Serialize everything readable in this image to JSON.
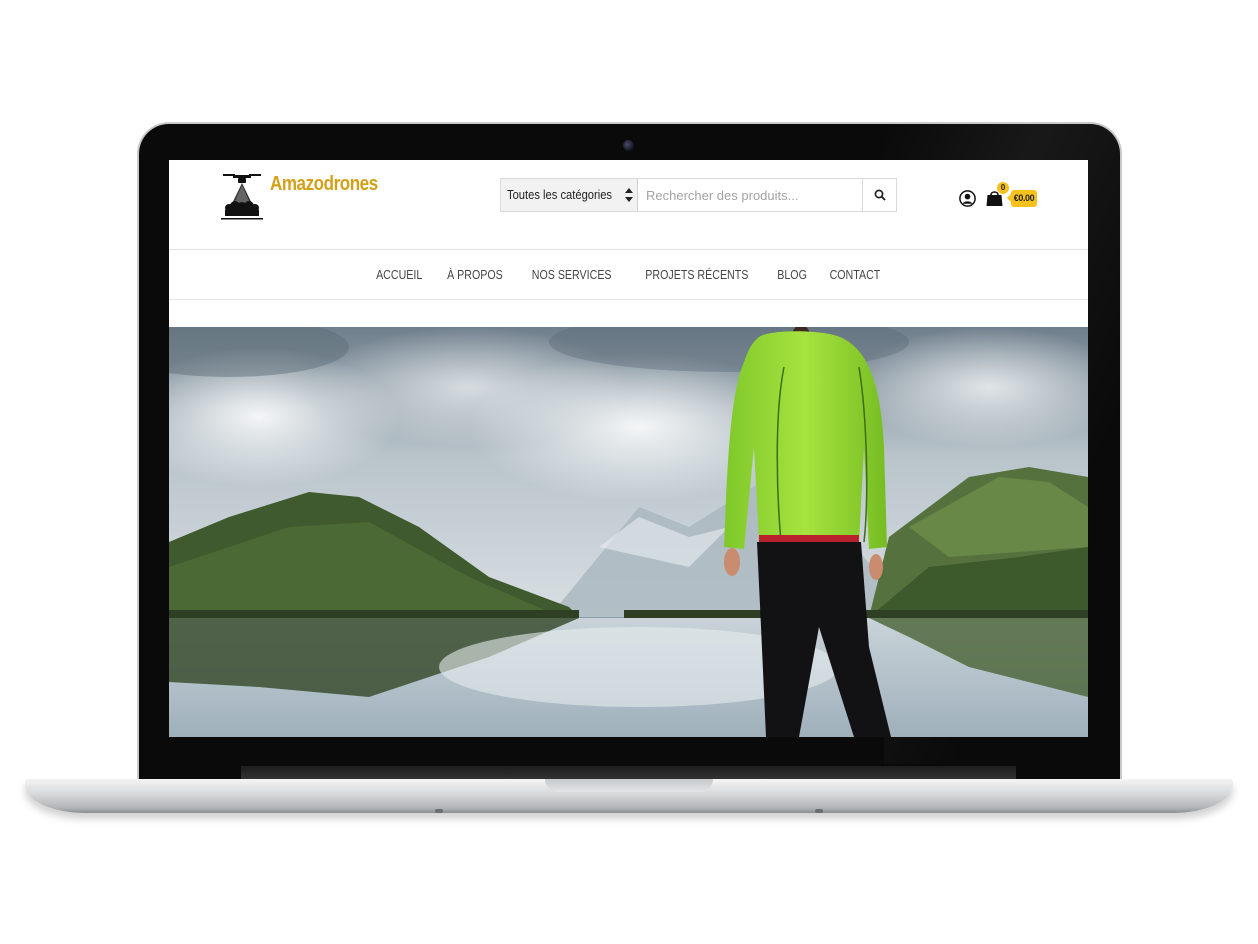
{
  "header": {
    "brand": "Amazodrones",
    "search": {
      "category_selected": "Toutes les catégories",
      "placeholder": "Rechercher des produits..."
    },
    "cart": {
      "count": "0",
      "total": "€0.00"
    }
  },
  "nav": {
    "items": [
      {
        "label": "ACCUEIL"
      },
      {
        "label": "À PROPOS"
      },
      {
        "label": "NOS SERVICES"
      },
      {
        "label": "PROJETS RÉCENTS"
      },
      {
        "label": "BLOG"
      },
      {
        "label": "CONTACT"
      }
    ]
  },
  "icons": {
    "logo": "drone-over-trees-logo",
    "search": "search-icon",
    "account": "user-circle-icon",
    "cart": "shopping-bag-icon"
  },
  "colors": {
    "brand": "#d4a017",
    "cart_badge": "#f7c21d"
  }
}
